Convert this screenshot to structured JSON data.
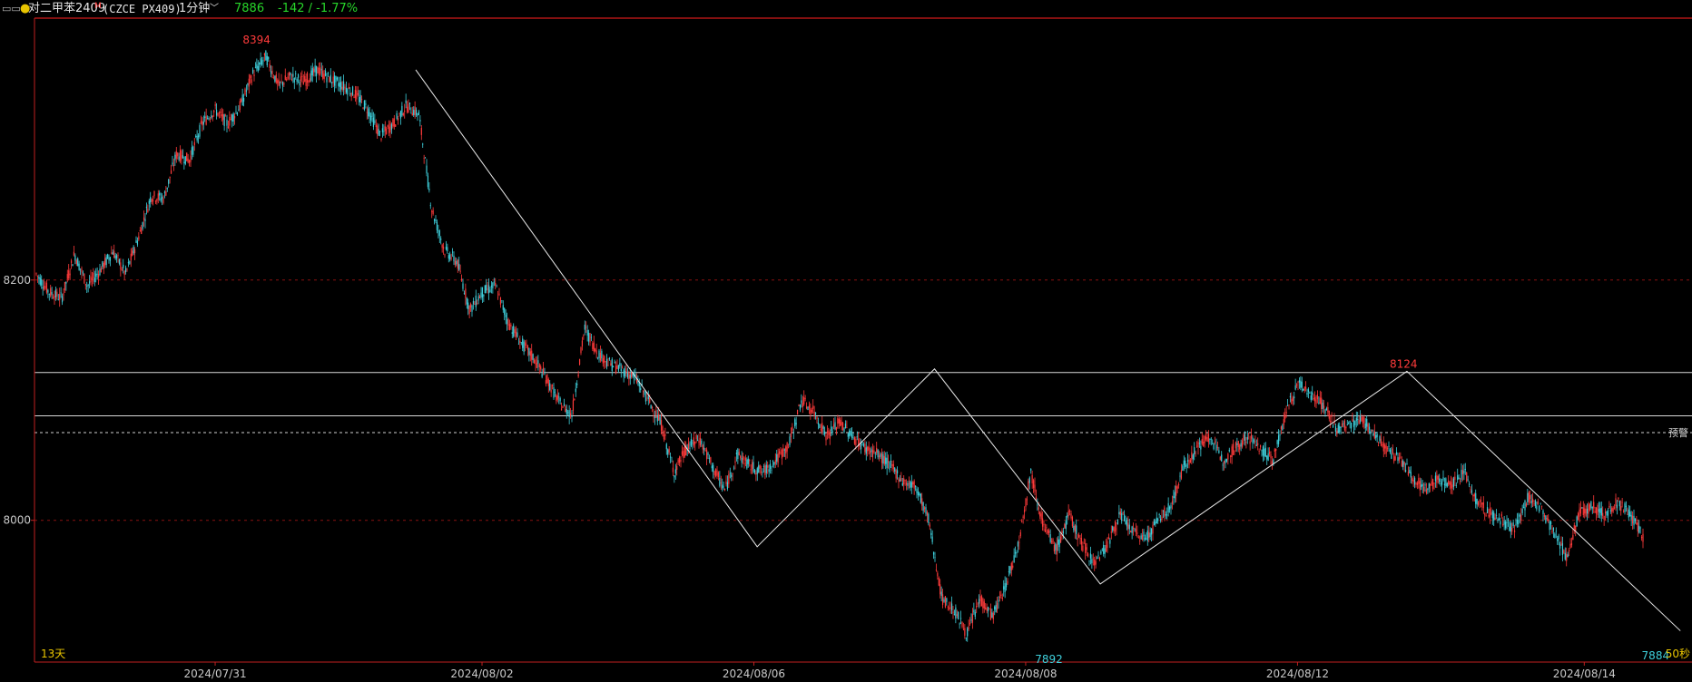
{
  "header": {
    "window_icon": "window-icon",
    "status_dot_color": "#e8c400",
    "instrument_name": "对二甲苯2409",
    "main_contract_flag": "M",
    "instrument_code": "(CZCE PX409)",
    "period": "1分钟",
    "period_icon": "chevron-down-icon",
    "last_price": "7886",
    "change": "-142 / -1.77%"
  },
  "chart_data": {
    "type": "line",
    "subtype": "candlestick",
    "title": "",
    "xlabel": "",
    "ylabel": "",
    "ylim": [
      7882,
      8418
    ],
    "x_ticks": [
      "2024/07/31",
      "2024/08/02",
      "2024/08/06",
      "2024/08/08",
      "2024/08/12",
      "2024/08/14"
    ],
    "y_ticks": [
      8200,
      8000
    ],
    "grid": "y-dashed",
    "bullish_color": "#ff3b3b",
    "bearish_color": "#3fd0dc",
    "series": [
      {
        "values": [
          8205,
          8190,
          8185,
          8222,
          8195,
          8208,
          8224,
          8205,
          8235,
          8270,
          8268,
          8305,
          8300,
          8330,
          8342,
          8330,
          8345,
          8372,
          8386,
          8362,
          8370,
          8365,
          8375,
          8368,
          8362,
          8355,
          8342,
          8320,
          8330,
          8345,
          8338,
          8260,
          8225,
          8215,
          8175,
          8190,
          8195,
          8165,
          8148,
          8135,
          8118,
          8098,
          8088,
          8160,
          8140,
          8130,
          8125,
          8118,
          8100,
          8080,
          8040,
          8060,
          8068,
          8045,
          8025,
          8055,
          8045,
          8040,
          8050,
          8062,
          8100,
          8090,
          8070,
          8082,
          8070,
          8060,
          8055,
          8045,
          8032,
          8028,
          8000,
          7935,
          7925,
          7905,
          7935,
          7920,
          7945,
          7980,
          8040,
          7995,
          7975,
          8005,
          7980,
          7965,
          7980,
          8005,
          7990,
          7985,
          8000,
          8012,
          8045,
          8060,
          8070,
          8050,
          8060,
          8070,
          8060,
          8050,
          8090,
          8115,
          8105,
          8095,
          8075,
          8080,
          8085,
          8070,
          8058,
          8050,
          8035,
          8025,
          8035,
          8030,
          8040,
          8015,
          8005,
          8000,
          7992,
          8020,
          8010,
          7990,
          7970,
          8005,
          8012,
          8005,
          8015,
          8005,
          7986
        ]
      }
    ],
    "high_marker": {
      "label": "8394",
      "value": 8394,
      "date": "2024/07/31"
    },
    "peak_marker": {
      "label": "8124",
      "value": 8124,
      "date": "2024/08/12"
    },
    "low_marker": {
      "label": "7892",
      "value": 7892,
      "date": "2024/08/08"
    },
    "last_marker": {
      "label": "7884",
      "value": 7884
    },
    "horizontal_lines": [
      8123,
      8087
    ],
    "alert_line": {
      "value": 8073,
      "label": "预警"
    },
    "trend_line_points": [
      {
        "x": 0.23,
        "y": 8375
      },
      {
        "x": 0.436,
        "y": 7978
      },
      {
        "x": 0.543,
        "y": 8126
      },
      {
        "x": 0.643,
        "y": 7947
      },
      {
        "x": 0.828,
        "y": 8124
      },
      {
        "x": 0.993,
        "y": 7908
      }
    ],
    "visible_days_label": "13天",
    "countdown_label": "50秒"
  }
}
